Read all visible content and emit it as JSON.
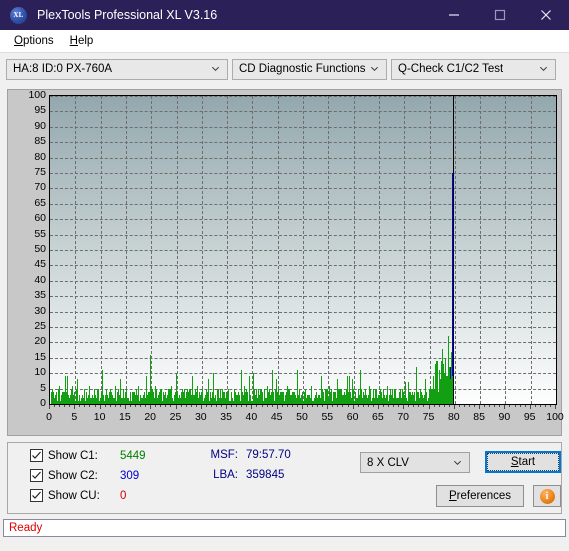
{
  "window": {
    "title": "PlexTools Professional XL V3.16",
    "app_icon": "XL",
    "minimize_label": "minimize-icon",
    "maximize_label": "maximize-icon",
    "close_label": "close-icon"
  },
  "menu": {
    "items": [
      {
        "label": "Options",
        "accel": "O"
      },
      {
        "label": "Help",
        "accel": "H"
      }
    ]
  },
  "selectors": {
    "drive": "HA:8 ID:0  PX-760A",
    "function_group": "CD Diagnostic Functions",
    "test": "Q-Check C1/C2 Test"
  },
  "controls": {
    "checkboxes": [
      {
        "label": "Show C1:",
        "value": "5449",
        "color": "#008000",
        "checked": true
      },
      {
        "label": "Show C2:",
        "value": "309",
        "color": "#0000cd",
        "checked": true
      },
      {
        "label": "Show CU:",
        "value": "0",
        "color": "#d00000",
        "checked": true
      }
    ],
    "msf_key": "MSF:",
    "msf_value": "79:57.70",
    "lba_key": "LBA:",
    "lba_value": "359845",
    "speed": "8 X CLV",
    "start_label": "Start",
    "start_accel": "S",
    "preferences_label": "Preferences",
    "preferences_accel": "P",
    "info_label": "i"
  },
  "status": {
    "text": "Ready"
  },
  "chart_data": {
    "type": "bar",
    "title": "",
    "xlabel": "",
    "ylabel": "",
    "xlim": [
      0,
      100
    ],
    "ylim": [
      0,
      100
    ],
    "x_ticks": [
      0,
      5,
      10,
      15,
      20,
      25,
      30,
      35,
      40,
      45,
      50,
      55,
      60,
      65,
      70,
      75,
      80,
      85,
      90,
      95,
      100
    ],
    "y_ticks": [
      0,
      5,
      10,
      15,
      20,
      25,
      30,
      35,
      40,
      45,
      50,
      55,
      60,
      65,
      70,
      75,
      80,
      85,
      90,
      95,
      100
    ],
    "grid": true,
    "legend_position": "none",
    "marker_line_x": 79.6,
    "marker_line_color": "#000000",
    "series": [
      {
        "name": "C1",
        "color": "#12a012",
        "x": [
          0.3,
          0.6,
          0.9,
          1.2,
          1.5,
          1.8,
          2.1,
          2.4,
          2.7,
          3.0,
          3.3,
          3.6,
          3.9,
          4.2,
          4.5,
          4.8,
          5.1,
          5.4,
          5.7,
          6.0,
          6.3,
          6.6,
          6.9,
          7.2,
          7.5,
          7.8,
          8.1,
          8.4,
          8.7,
          9.0,
          9.3,
          9.6,
          9.9,
          10.2,
          10.5,
          10.8,
          11.1,
          11.4,
          11.7,
          12.0,
          12.3,
          12.6,
          12.9,
          13.2,
          13.5,
          13.8,
          14.1,
          14.4,
          14.7,
          15.0,
          15.3,
          15.6,
          15.9,
          16.2,
          16.5,
          16.8,
          17.1,
          17.4,
          17.7,
          18.0,
          18.3,
          18.6,
          18.9,
          19.2,
          19.5,
          19.8,
          20.1,
          20.4,
          20.7,
          21.0,
          21.3,
          21.6,
          21.9,
          22.2,
          22.5,
          22.8,
          23.1,
          23.4,
          23.7,
          24.0,
          24.3,
          24.6,
          24.9,
          25.2,
          25.5,
          25.8,
          26.1,
          26.4,
          26.7,
          27.0,
          27.3,
          27.6,
          27.9,
          28.2,
          28.5,
          28.8,
          29.1,
          29.4,
          29.7,
          30.0,
          30.3,
          30.6,
          30.9,
          31.2,
          31.5,
          31.8,
          32.1,
          32.4,
          32.7,
          33.0,
          33.3,
          33.6,
          33.9,
          34.2,
          34.5,
          34.8,
          35.1,
          35.4,
          35.7,
          36.0,
          36.3,
          36.6,
          36.9,
          37.2,
          37.5,
          37.8,
          38.1,
          38.4,
          38.7,
          39.0,
          39.3,
          39.6,
          39.9,
          40.2,
          40.5,
          40.8,
          41.1,
          41.4,
          41.7,
          42.0,
          42.3,
          42.6,
          42.9,
          43.2,
          43.5,
          43.8,
          44.1,
          44.4,
          44.7,
          45.0,
          45.3,
          45.6,
          45.9,
          46.2,
          46.5,
          46.8,
          47.1,
          47.4,
          47.7,
          48.0,
          48.3,
          48.6,
          48.9,
          49.2,
          49.5,
          49.8,
          50.1,
          50.4,
          50.7,
          51.0,
          51.3,
          51.6,
          51.9,
          52.2,
          52.5,
          52.8,
          53.1,
          53.4,
          53.7,
          54.0,
          54.3,
          54.6,
          54.9,
          55.2,
          55.5,
          55.8,
          56.1,
          56.4,
          56.7,
          57.0,
          57.3,
          57.6,
          57.9,
          58.2,
          58.5,
          58.8,
          59.1,
          59.4,
          59.7,
          60.0,
          60.3,
          60.6,
          60.9,
          61.2,
          61.5,
          61.8,
          62.1,
          62.4,
          62.7,
          63.0,
          63.3,
          63.6,
          63.9,
          64.2,
          64.5,
          64.8,
          65.1,
          65.4,
          65.7,
          66.0,
          66.3,
          66.6,
          66.9,
          67.2,
          67.5,
          67.8,
          68.1,
          68.4,
          68.7,
          69.0,
          69.3,
          69.6,
          69.9,
          70.2,
          70.5,
          70.8,
          71.1,
          71.4,
          71.7,
          72.0,
          72.3,
          72.6,
          72.9,
          73.2,
          73.5,
          73.8,
          74.1,
          74.4,
          74.7,
          75.0,
          75.3,
          75.6,
          75.9,
          76.2,
          76.5,
          76.8,
          77.1,
          77.4,
          77.7,
          78.0,
          78.3,
          78.6,
          78.9,
          79.2,
          79.5
        ],
        "values": [
          2,
          3,
          1,
          4,
          2,
          6,
          2,
          1,
          3,
          2,
          9,
          3,
          2,
          5,
          1,
          4,
          2,
          8,
          2,
          1,
          3,
          2,
          1,
          4,
          2,
          6,
          2,
          1,
          5,
          2,
          3,
          1,
          2,
          11,
          3,
          1,
          5,
          2,
          4,
          1,
          3,
          2,
          6,
          2,
          1,
          4,
          2,
          3,
          1,
          5,
          2,
          1,
          3,
          2,
          4,
          1,
          2,
          6,
          2,
          1,
          3,
          2,
          9,
          2,
          1,
          16,
          4,
          2,
          6,
          1,
          3,
          2,
          5,
          1,
          2,
          4,
          1,
          3,
          2,
          6,
          1,
          2,
          4,
          1,
          3,
          2,
          5,
          1,
          2,
          3,
          1,
          4,
          2,
          1,
          3,
          2,
          6,
          1,
          2,
          4,
          1,
          3,
          2,
          8,
          1,
          2,
          4,
          1,
          3,
          2,
          5,
          1,
          2,
          3,
          1,
          4,
          2,
          1,
          3,
          2,
          5,
          1,
          2,
          4,
          1,
          3,
          2,
          6,
          1,
          2,
          9,
          3,
          1,
          4,
          2,
          5,
          1,
          2,
          3,
          1,
          4,
          2,
          6,
          1,
          2,
          3,
          1,
          5,
          2,
          1,
          3,
          2,
          4,
          1,
          2,
          6,
          1,
          3,
          2,
          4,
          1,
          2,
          11,
          3,
          1,
          4,
          2,
          5,
          1,
          3,
          2,
          6,
          1,
          2,
          4,
          1,
          3,
          2,
          5,
          1,
          2,
          3,
          1,
          6,
          2,
          1,
          4,
          2,
          3,
          1,
          5,
          2,
          1,
          3,
          2,
          4,
          1,
          2,
          8,
          1,
          3,
          2,
          5,
          1,
          2,
          4,
          1,
          3,
          2,
          6,
          1,
          2,
          3,
          1,
          5,
          2,
          1,
          4,
          2,
          3,
          1,
          6,
          2,
          1,
          3,
          2,
          5,
          1,
          2,
          4,
          1,
          3,
          2,
          7,
          1,
          2,
          4,
          1,
          3,
          2,
          12,
          2,
          1,
          5,
          3,
          2,
          8,
          4,
          2,
          6,
          3,
          9,
          5,
          14,
          7,
          11,
          6,
          18,
          9,
          13,
          8,
          22,
          12,
          17,
          10,
          20,
          14,
          24,
          16,
          21,
          13
        ]
      },
      {
        "name": "C2",
        "color": "#0000ee",
        "x": [
          77.1,
          77.4,
          78.3,
          78.6,
          79.1,
          79.3,
          79.4,
          79.5
        ],
        "values": [
          2,
          1,
          3,
          2,
          12,
          4,
          2,
          75
        ]
      }
    ]
  }
}
